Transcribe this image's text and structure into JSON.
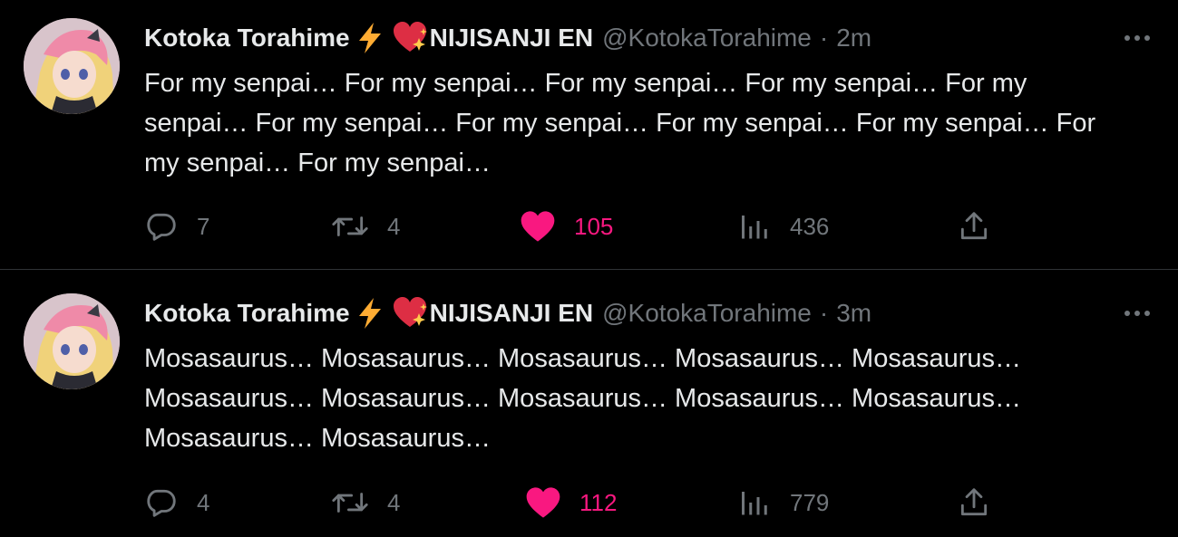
{
  "colors": {
    "background": "#000000",
    "text": "#e7e9ea",
    "muted": "#71767b",
    "like": "#f91880",
    "divider": "#2f3336"
  },
  "tweets": [
    {
      "display_name": "Kotoka Torahime",
      "emoji_1": "high-voltage-icon",
      "emoji_2": "sparkling-heart-icon",
      "affiliation": "NIJISANJI EN",
      "handle": "@KotokaTorahime",
      "separator": "·",
      "time": "2m",
      "text": "For my senpai… For my senpai… For my senpai… For my senpai… For my senpai… For my senpai… For my senpai… For my senpai… For my senpai… For my senpai… For my senpai…",
      "replies": "7",
      "retweets": "4",
      "likes": "105",
      "liked": true,
      "views": "436"
    },
    {
      "display_name": "Kotoka Torahime",
      "emoji_1": "high-voltage-icon",
      "emoji_2": "sparkling-heart-icon",
      "affiliation": "NIJISANJI EN",
      "handle": "@KotokaTorahime",
      "separator": "·",
      "time": "3m",
      "text": "Mosasaurus… Mosasaurus… Mosasaurus… Mosasaurus… Mosasaurus… Mosasaurus… Mosasaurus… Mosasaurus… Mosasaurus… Mosasaurus… Mosasaurus… Mosasaurus…",
      "replies": "4",
      "retweets": "4",
      "likes": "112",
      "liked": true,
      "views": "779"
    }
  ]
}
